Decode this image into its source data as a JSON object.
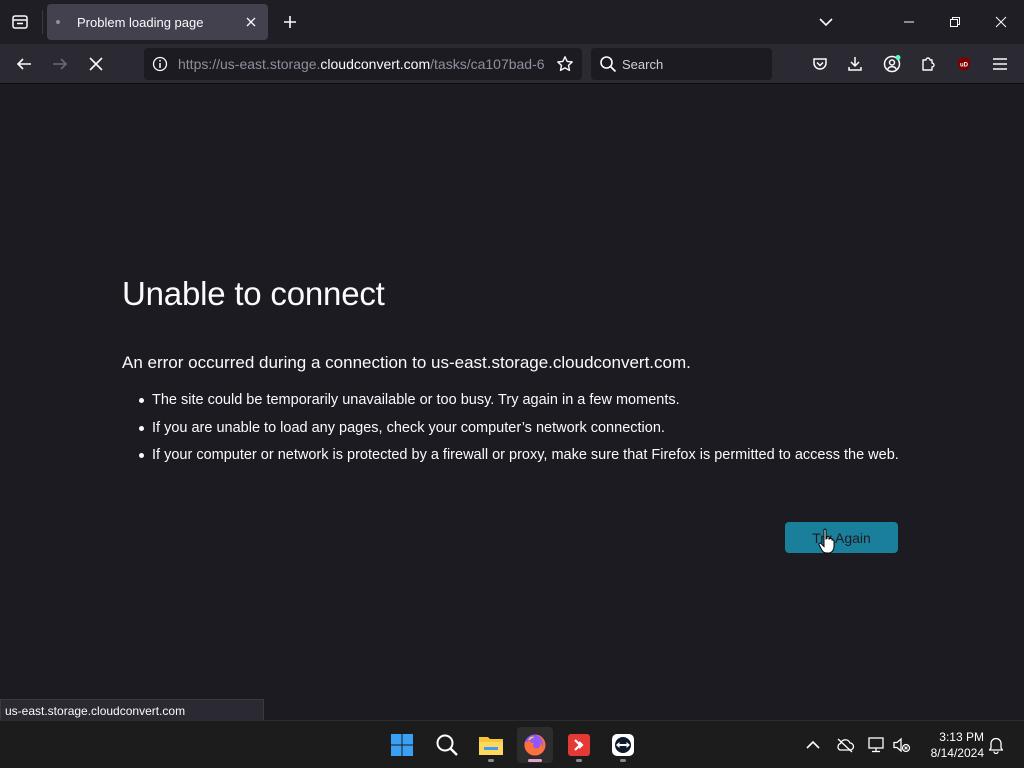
{
  "tab": {
    "title": "Problem loading page"
  },
  "urlbar": {
    "prefix": "https://us-east.storage.",
    "host": "cloudconvert.com",
    "path": "/tasks/ca107bad-6"
  },
  "searchbar": {
    "placeholder": "Search"
  },
  "error": {
    "title": "Unable to connect",
    "description": "An error occurred during a connection to us-east.storage.cloudconvert.com.",
    "items": [
      "The site could be temporarily unavailable or too busy. Try again in a few moments.",
      "If you are unable to load any pages, check your computer’s network connection.",
      "If your computer or network is protected by a firewall or proxy, make sure that Firefox is permitted to access the web."
    ],
    "button": "Try Again"
  },
  "statusbar": {
    "text": "us-east.storage.cloudconvert.com"
  },
  "taskbar": {
    "time": "3:13 PM",
    "date": "8/14/2024"
  },
  "colors": {
    "accent_button": "#1a7f9b",
    "page_bg": "#1c1b22",
    "toolbar_bg": "#2b2a33"
  }
}
